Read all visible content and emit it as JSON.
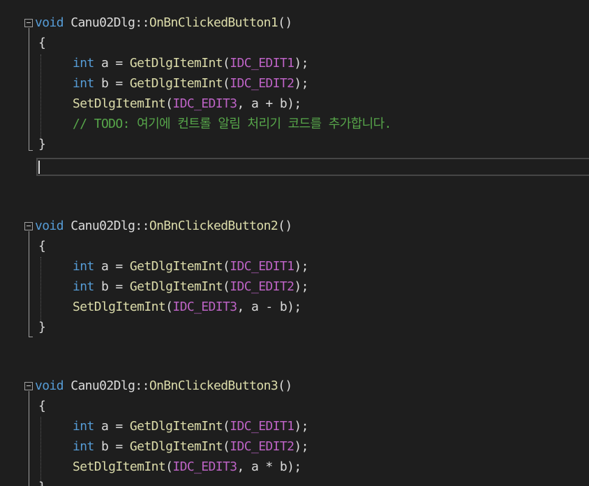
{
  "blocks": [
    {
      "signature": {
        "kw": "void",
        "cls": "Canu02Dlg",
        "sep": "::",
        "fn": "OnBnClickedButton1",
        "rest": "()"
      },
      "open": "{",
      "line1": {
        "kw": "int",
        "var": " a = ",
        "fn": "GetDlgItemInt",
        "p1": "(",
        "macro": "IDC_EDIT1",
        "p2": ");"
      },
      "line2": {
        "kw": "int",
        "var": " b = ",
        "fn": "GetDlgItemInt",
        "p1": "(",
        "macro": "IDC_EDIT2",
        "p2": ");"
      },
      "line3": {
        "fn": "SetDlgItemInt",
        "p1": "(",
        "macro": "IDC_EDIT3",
        "rest": ", a + b);"
      },
      "comment": "// TODO: 여기에 컨트롤 알림 처리기 코드를 추가합니다.",
      "close": "}"
    },
    {
      "signature": {
        "kw": "void",
        "cls": "Canu02Dlg",
        "sep": "::",
        "fn": "OnBnClickedButton2",
        "rest": "()"
      },
      "open": "{",
      "line1": {
        "kw": "int",
        "var": " a = ",
        "fn": "GetDlgItemInt",
        "p1": "(",
        "macro": "IDC_EDIT1",
        "p2": ");"
      },
      "line2": {
        "kw": "int",
        "var": " b = ",
        "fn": "GetDlgItemInt",
        "p1": "(",
        "macro": "IDC_EDIT2",
        "p2": ");"
      },
      "line3": {
        "fn": "SetDlgItemInt",
        "p1": "(",
        "macro": "IDC_EDIT3",
        "rest": ", a - b);"
      },
      "close": "}"
    },
    {
      "signature": {
        "kw": "void",
        "cls": "Canu02Dlg",
        "sep": "::",
        "fn": "OnBnClickedButton3",
        "rest": "()"
      },
      "open": "{",
      "line1": {
        "kw": "int",
        "var": " a = ",
        "fn": "GetDlgItemInt",
        "p1": "(",
        "macro": "IDC_EDIT1",
        "p2": ");"
      },
      "line2": {
        "kw": "int",
        "var": " b = ",
        "fn": "GetDlgItemInt",
        "p1": "(",
        "macro": "IDC_EDIT2",
        "p2": ");"
      },
      "line3": {
        "fn": "SetDlgItemInt",
        "p1": "(",
        "macro": "IDC_EDIT3",
        "rest": ", a * b);"
      },
      "close": "}"
    }
  ],
  "colors": {
    "background": "#1e1e1e",
    "keyword": "#569cd6",
    "function": "#dcdcaa",
    "class": "#4ec9b0",
    "macro": "#bd63c5",
    "comment": "#57a64a",
    "text": "#dcdcdc"
  }
}
